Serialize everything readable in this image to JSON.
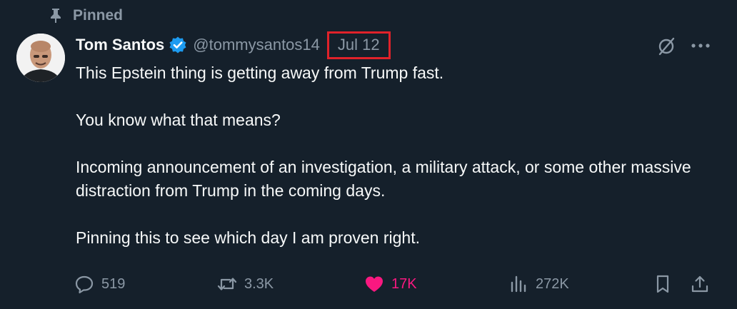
{
  "pinned_label": "Pinned",
  "author": {
    "name": "Tom Santos",
    "handle": "@tommysantos14",
    "date": "Jul 12"
  },
  "body": [
    "This Epstein thing is getting away from Trump fast.",
    "You know what that means?",
    "Incoming announcement of an investigation, a military attack, or some other massive distraction from Trump in the coming days.",
    "Pinning this to see which day I am proven right."
  ],
  "stats": {
    "replies": "519",
    "reposts": "3.3K",
    "likes": "17K",
    "views": "272K"
  },
  "icons": {
    "pinned": "pin-icon",
    "verified": "verified-badge-icon",
    "grok": "grok-icon",
    "more": "more-icon",
    "reply": "reply-icon",
    "repost": "repost-icon",
    "like": "heart-icon",
    "views": "views-icon",
    "bookmark": "bookmark-icon",
    "share": "share-icon"
  },
  "colors": {
    "background": "#15202b",
    "text": "#f7f9f9",
    "muted": "#8b98a5",
    "verified": "#1d9bf0",
    "like": "#f91880",
    "highlight_box": "#e0222a"
  }
}
